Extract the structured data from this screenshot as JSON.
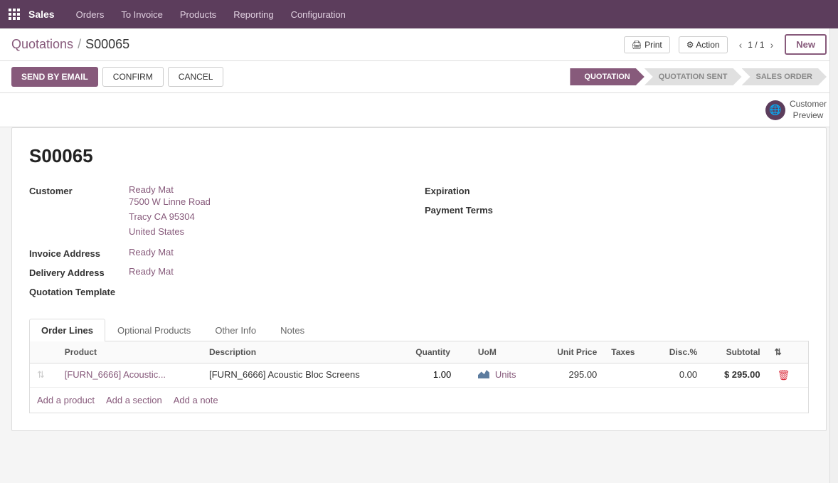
{
  "app": {
    "name": "Sales",
    "nav_items": [
      "Orders",
      "To Invoice",
      "Products",
      "Reporting",
      "Configuration"
    ]
  },
  "header": {
    "breadcrumb_parent": "Quotations",
    "breadcrumb_separator": "/",
    "breadcrumb_current": "S00065",
    "print_label": "Print",
    "action_label": "Action",
    "pager": "1 / 1",
    "new_label": "New"
  },
  "actions": {
    "send_email": "SEND BY EMAIL",
    "confirm": "CONFIRM",
    "cancel": "CANCEL"
  },
  "status_pipeline": [
    {
      "label": "QUOTATION",
      "active": true
    },
    {
      "label": "QUOTATION SENT",
      "active": false
    },
    {
      "label": "SALES ORDER",
      "active": false
    }
  ],
  "customer_preview": {
    "label": "Customer\nPreview"
  },
  "form": {
    "order_number": "S00065",
    "fields": {
      "customer_label": "Customer",
      "customer_name": "Ready Mat",
      "customer_address1": "7500 W Linne Road",
      "customer_address2": "Tracy CA 95304",
      "customer_address3": "United States",
      "invoice_address_label": "Invoice Address",
      "invoice_address": "Ready Mat",
      "delivery_address_label": "Delivery Address",
      "delivery_address": "Ready Mat",
      "quotation_template_label": "Quotation Template",
      "expiration_label": "Expiration",
      "payment_terms_label": "Payment Terms"
    }
  },
  "tabs": [
    {
      "label": "Order Lines",
      "active": true
    },
    {
      "label": "Optional Products",
      "active": false
    },
    {
      "label": "Other Info",
      "active": false
    },
    {
      "label": "Notes",
      "active": false
    }
  ],
  "table": {
    "columns": [
      "",
      "Product",
      "Description",
      "Quantity",
      "UoM",
      "Unit Price",
      "Taxes",
      "Disc.%",
      "Subtotal",
      ""
    ],
    "rows": [
      {
        "drag": "⇅",
        "product": "[FURN_6666] Acoustic...",
        "description": "[FURN_6666] Acoustic Bloc Screens",
        "quantity": "1.00",
        "uom": "Units",
        "unit_price": "295.00",
        "taxes": "",
        "discount": "0.00",
        "subtotal": "$ 295.00"
      }
    ]
  },
  "add_links": {
    "add_product": "Add a product",
    "add_section": "Add a section",
    "add_note": "Add a note"
  }
}
